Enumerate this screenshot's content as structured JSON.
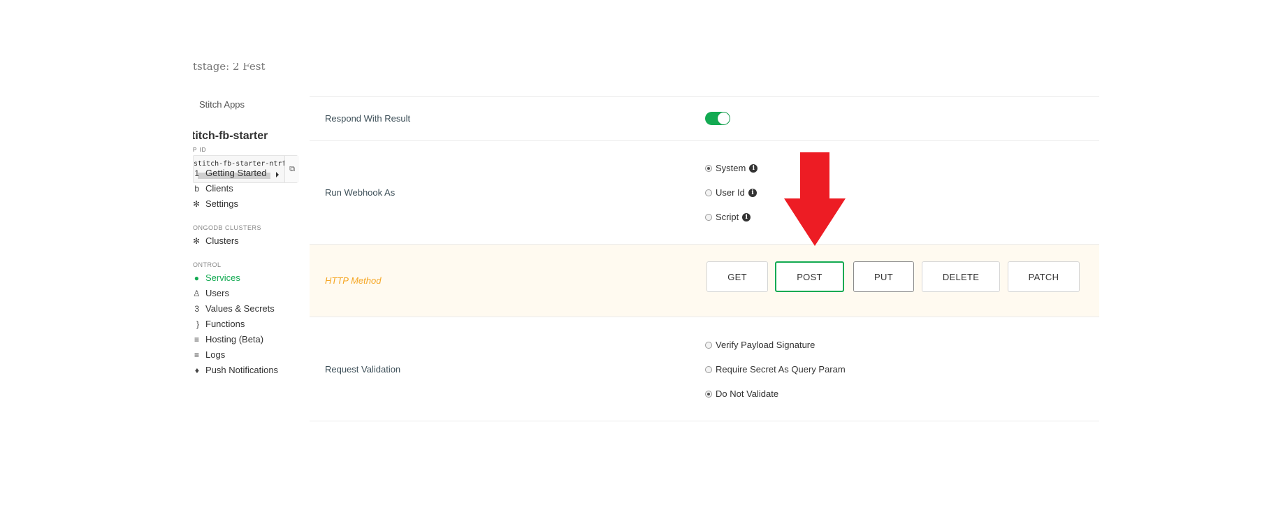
{
  "sidebar": {
    "cut_title": "tstage: 2 Fest",
    "back_link": "Stitch Apps",
    "app_name": "titch-fb-starter",
    "app_id_label": "P ID",
    "app_id_value": "stitch-fb-starter-ntrfl",
    "nav_top": [
      {
        "glyph": "1",
        "label": "Getting Started"
      },
      {
        "glyph": "b",
        "label": "Clients"
      },
      {
        "glyph": "✻",
        "label": "Settings"
      }
    ],
    "section_clusters": "ONGODB CLUSTERS",
    "nav_clusters": [
      {
        "glyph": "✻",
        "label": "Clusters"
      }
    ],
    "section_control": "ONTROL",
    "nav_control": [
      {
        "glyph": "●",
        "label": "Services",
        "active": true
      },
      {
        "glyph": "♙",
        "label": "Users"
      },
      {
        "glyph": "3",
        "label": "Values & Secrets"
      },
      {
        "glyph": "}",
        "label": "Functions"
      },
      {
        "glyph": "≡",
        "label": "Hosting (Beta)"
      },
      {
        "glyph": "≡",
        "label": "Logs"
      },
      {
        "glyph": "♦",
        "label": "Push Notifications"
      }
    ]
  },
  "settings": {
    "respond_with_result": {
      "label": "Respond With Result",
      "enabled": true
    },
    "run_webhook_as": {
      "label": "Run Webhook As",
      "options": [
        {
          "label": "System",
          "selected": true,
          "info": true
        },
        {
          "label": "User Id",
          "selected": false,
          "info": true
        },
        {
          "label": "Script",
          "selected": false,
          "info": true
        }
      ]
    },
    "http_method": {
      "label": "HTTP Method",
      "options": [
        "GET",
        "POST",
        "PUT",
        "DELETE",
        "PATCH"
      ],
      "selected": "POST"
    },
    "request_validation": {
      "label": "Request Validation",
      "options": [
        {
          "label": "Verify Payload Signature",
          "selected": false
        },
        {
          "label": "Require Secret As Query Param",
          "selected": false
        },
        {
          "label": "Do Not Validate",
          "selected": true
        }
      ]
    }
  },
  "colors": {
    "accent_green": "#13aa52",
    "highlight_orange": "#f5a623",
    "annotation_red": "#ed1c24"
  },
  "icons": {
    "info": "info-icon",
    "copy": "copy-icon",
    "annotation": "red-down-arrow-icon"
  }
}
